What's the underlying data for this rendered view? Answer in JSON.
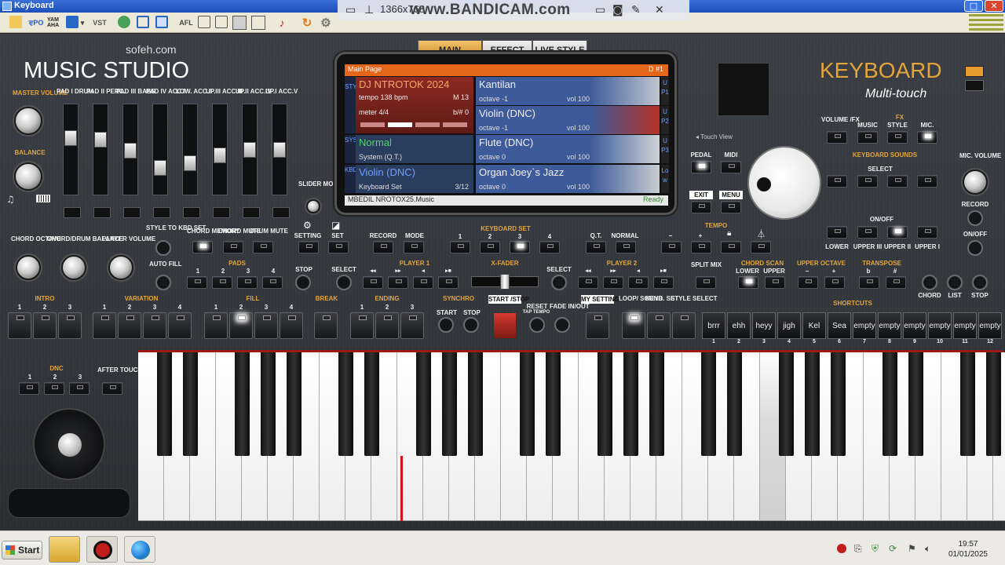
{
  "window": {
    "title": "Keyboard",
    "max": "□",
    "close": "✕"
  },
  "toolbar": {
    "items": [
      "open-icon",
      "midi-icon",
      "yamaha-icon",
      "save-icon",
      "vst",
      "mixer-icon",
      "resize-icon",
      "window-icon",
      "afl",
      "layout1-icon",
      "layout2-icon",
      "layout3-icon",
      "note-icon",
      "refresh-icon",
      "settings-icon"
    ],
    "vst_label": "VST",
    "afl_label": "AFL",
    "ypo_label": "ਞPO",
    "yam_label": "YAM AHA"
  },
  "recorder": {
    "resolution": "1366x768",
    "brand": "www.BANDICAM.com"
  },
  "brand": {
    "site": "sofeh.com",
    "name": "MUSIC STUDIO",
    "product": "KEYBOARD",
    "sub": "Multi-touch"
  },
  "left": {
    "master_volume": "MASTER VOLUME",
    "balance": "BALANCE",
    "chord_octave": "CHORD OCTAVE",
    "chord_drum_balance": "CHORD/DRUM BALANCE",
    "player_volume": "PLAYER VOLUME"
  },
  "sliders": {
    "labels": [
      "PAD I DRUM",
      "PAD II PERC.",
      "PAD III BASS",
      "PAD IV ACC.I",
      "LOW. ACC.II",
      "UP.III ACC.III",
      "UP.II ACC.IV",
      "UP.I ACC.V"
    ],
    "levels": [
      0.65,
      0.63,
      0.48,
      0.25,
      0.32,
      0.42,
      0.5,
      0.5
    ]
  },
  "slider_mode": "SLIDER MODE",
  "tabs": [
    "MAIN",
    "EFFECT",
    "LIVE STYLE"
  ],
  "display": {
    "header": "Main Page",
    "header_right": "D #1",
    "style": {
      "name": "DJ NTROTOK 2024",
      "tempo": "tempo 138 bpm",
      "measure": "M 13",
      "meter": "meter 4/4",
      "key": "b/# 0"
    },
    "sys": {
      "name": "Normal",
      "sub": "System (Q.T.)"
    },
    "kbd": {
      "name": "Violin (DNC)",
      "sub": "Keyboard Set",
      "count": "3/12"
    },
    "side_style": "STYLE",
    "side_sys": "SYS",
    "side_kbd": "KBD",
    "upper": [
      {
        "tag": "UP1",
        "name": "Kantilan",
        "octave": "octave -1",
        "vol": "vol 100"
      },
      {
        "tag": "UP2",
        "name": "Violin (DNC)",
        "octave": "octave -1",
        "vol": "vol 100"
      },
      {
        "tag": "UP3",
        "name": "Flute (DNC)",
        "octave": "octave 0",
        "vol": "vol 100"
      },
      {
        "tag": "Low",
        "name": "Organ Joey`s Jazz",
        "octave": "octave 0",
        "vol": "vol 100"
      }
    ],
    "footer": "MBEDIL NROTOX25.Music",
    "status": "Ready"
  },
  "right": {
    "touch_view": "Touch View",
    "volume_fx": "VOLUME /FX",
    "fx": "FX",
    "music": "MUSIC",
    "style": "STYLE",
    "mic": "MIC.",
    "pedal": "PEDAL",
    "midi": "MIDI",
    "exit": "EXIT",
    "menu": "MENU",
    "keyboard_sounds": "KEYBOARD SOUNDS",
    "select": "SELECT",
    "on_off": "ON/OFF",
    "lower": "LOWER",
    "upper_iii": "UPPER III",
    "upper_ii": "UPPER II",
    "upper_i": "UPPER I",
    "mic_volume": "MIC. VOLUME",
    "record": "RECORD",
    "onoff2": "ON/OFF"
  },
  "mid": {
    "style_to_kbd": "STYLE TO KBD SET",
    "chord_memory": "CHORD MEMORY",
    "chord_mute": "CHORD MUTE",
    "drum_mute": "DRUM MUTE",
    "setting": "SETTING",
    "set": "SET",
    "record": "RECORD",
    "mode": "MODE",
    "keyboard_set": "KEYBOARD SET",
    "qt": "Q.T.",
    "normal": "NORMAL",
    "tempo": "TEMPO",
    "auto_fill": "AUTO FILL",
    "pads": "PADS",
    "stop": "STOP",
    "select": "SELECT",
    "player1": "PLAYER 1",
    "xfader": "X-FADER",
    "player2": "PLAYER 2",
    "split_mix": "SPLIT MIX",
    "chord_scan": "CHORD SCAN",
    "lower": "LOWER",
    "upper": "UPPER",
    "upper_octave": "UPPER OCTAVE",
    "transpose": "TRANSPOSE",
    "b": "b",
    "sharp": "#",
    "chord": "CHORD",
    "list": "LIST",
    "stop2": "STOP",
    "intro": "INTRO",
    "variation": "VARIATION",
    "fill": "FILL",
    "break": "BREAK",
    "ending": "ENDING",
    "synchro": "SYNCHRO",
    "start_stop": "START /STOP",
    "start": "START",
    "stop3": "STOP",
    "reset": "RESET",
    "tap_tempo": "TAP TEMPO",
    "fade": "FADE IN/OUT",
    "my_setting": "MY SETTING",
    "loop_sound": "LOOP/ SOUND",
    "keyb_set": "KEYB. SET",
    "style_select": "STYLE SELECT",
    "shortcuts": "SHORTCUTS",
    "dnc": "DNC",
    "after_touch": "AFTER TOUCH",
    "minus": "−",
    "plus": "+",
    "one": "1",
    "two": "2",
    "three": "3",
    "four": "4"
  },
  "shortcut_slots": [
    {
      "label": "brrr",
      "n": "1"
    },
    {
      "label": "ehh",
      "n": "2"
    },
    {
      "label": "heyy",
      "n": "3"
    },
    {
      "label": "jigh",
      "n": "4"
    },
    {
      "label": "Kel",
      "n": "5"
    },
    {
      "label": "Sea",
      "n": "6"
    },
    {
      "label": "empty",
      "n": "7"
    },
    {
      "label": "empty",
      "n": "8"
    },
    {
      "label": "empty",
      "n": "9"
    },
    {
      "label": "empty",
      "n": "10"
    },
    {
      "label": "empty",
      "n": "11"
    },
    {
      "label": "empty",
      "n": "12"
    }
  ],
  "taskbar": {
    "start": "Start",
    "time": "19:57",
    "date": "01/01/2025"
  },
  "colors": {
    "accent": "#e5671c",
    "gold": "#e3a53a",
    "cell_blue": "#3d5a9a",
    "style_red": "#7a241e"
  }
}
